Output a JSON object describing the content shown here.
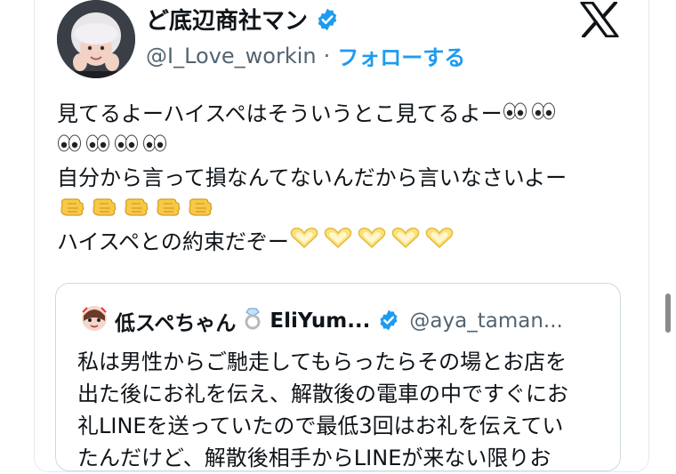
{
  "author": {
    "name": "ど底辺商社マン",
    "handle": "@I_Love_workin",
    "separator": "·",
    "follow_label": "フォローする"
  },
  "tweet": {
    "line1": "見てるよーハイスペはそういうとこ見てるよー",
    "line3": "自分から言って損なんてないんだから言いなさいよー",
    "line5": "ハイスペとの約束だぞー"
  },
  "quote": {
    "name": "低スペちゃん",
    "name_suffix": "EliYum...",
    "handle": "@aya_taman...",
    "lines": [
      "私は男性からご馳走してもらったらその場とお店を",
      "出た後にお礼を伝え、解散後の電車の中ですぐにお",
      "礼LINEを送っていたので最低3回はお礼を伝えてい",
      "たんだけど、解散後相手からLINEが来ない限りお"
    ]
  },
  "colors": {
    "accent": "#1d9bf0",
    "secondary_text": "#536471",
    "text": "#0f1419",
    "border": "#cfd9de"
  },
  "icons": {
    "verified": "verified-badge-icon",
    "logo": "x-logo-icon",
    "eyes": "eyes-emoji",
    "hand": "pointing-hand-emoji",
    "heart": "heart-hands-emoji",
    "ring": "ring-emoji",
    "quote_avatar": "ghost-face-emoji"
  }
}
